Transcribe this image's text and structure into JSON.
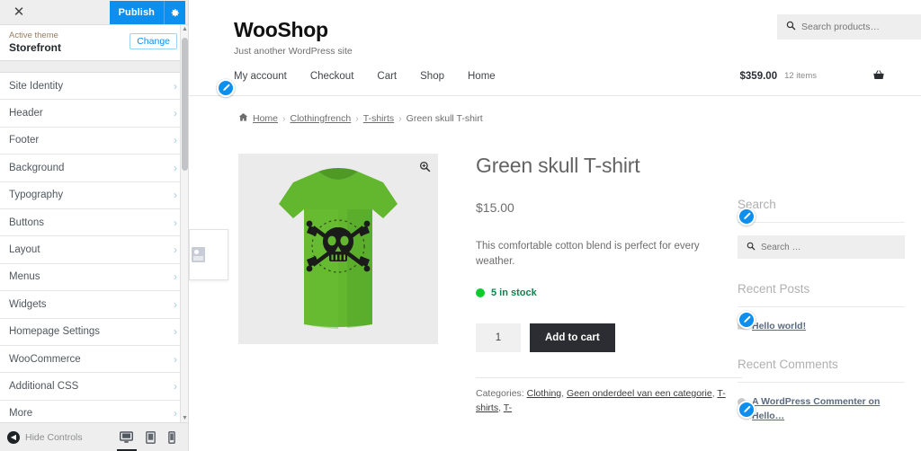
{
  "customizer": {
    "close_label": "✕",
    "publish_label": "Publish",
    "gear_icon": "gear-icon",
    "active_theme_label": "Active theme",
    "active_theme_name": "Storefront",
    "change_label": "Change",
    "sections": [
      {
        "label": "Site Identity"
      },
      {
        "label": "Header"
      },
      {
        "label": "Footer"
      },
      {
        "label": "Background"
      },
      {
        "label": "Typography"
      },
      {
        "label": "Buttons"
      },
      {
        "label": "Layout"
      },
      {
        "label": "Menus"
      },
      {
        "label": "Widgets"
      },
      {
        "label": "Homepage Settings"
      },
      {
        "label": "WooCommerce"
      },
      {
        "label": "Additional CSS"
      },
      {
        "label": "More"
      }
    ],
    "footer": {
      "hide_controls_label": "Hide Controls",
      "devices": [
        {
          "name": "desktop",
          "active": true
        },
        {
          "name": "tablet",
          "active": false
        },
        {
          "name": "mobile",
          "active": false
        }
      ]
    },
    "accent_color": "#0d8ff0"
  },
  "preview": {
    "site_title": "WooShop",
    "site_description": "Just another WordPress site",
    "product_search": {
      "placeholder": "Search products…"
    },
    "nav": [
      {
        "label": "My account"
      },
      {
        "label": "Checkout"
      },
      {
        "label": "Cart"
      },
      {
        "label": "Shop"
      },
      {
        "label": "Home"
      }
    ],
    "cart": {
      "amount": "$359.00",
      "count": "12 items",
      "icon": "shopping-basket-icon"
    },
    "breadcrumb": [
      {
        "label": "Home",
        "link": true
      },
      {
        "label": "Clothingfrench",
        "link": true
      },
      {
        "label": "T-shirts",
        "link": true
      },
      {
        "label": "Green skull T-shirt",
        "link": false
      }
    ],
    "breadcrumb_separator": "›",
    "product": {
      "title": "Green skull T-shirt",
      "price": "$15.00",
      "description": "This comfortable cotton blend is perfect for every weather.",
      "stock": "5 in stock",
      "stock_color": "#0ecc2e",
      "quantity": "1",
      "add_to_cart_label": "Add to cart",
      "image_alt": "green-skull-tshirt-image",
      "zoom_icon": "magnifier-plus-icon",
      "meta_prefix": "Categories:",
      "categories": [
        "Clothing",
        "Geen onderdeel van een categorie",
        "T-shirts",
        "T-"
      ]
    }
  },
  "widgets": [
    {
      "title": "Search",
      "type": "search",
      "placeholder": "Search …"
    },
    {
      "title": "Recent Posts",
      "type": "posts",
      "items": [
        {
          "label": "Hello world!"
        }
      ]
    },
    {
      "title": "Recent Comments",
      "type": "comments",
      "items": [
        {
          "label": "A WordPress Commenter on Hello…"
        }
      ]
    }
  ]
}
